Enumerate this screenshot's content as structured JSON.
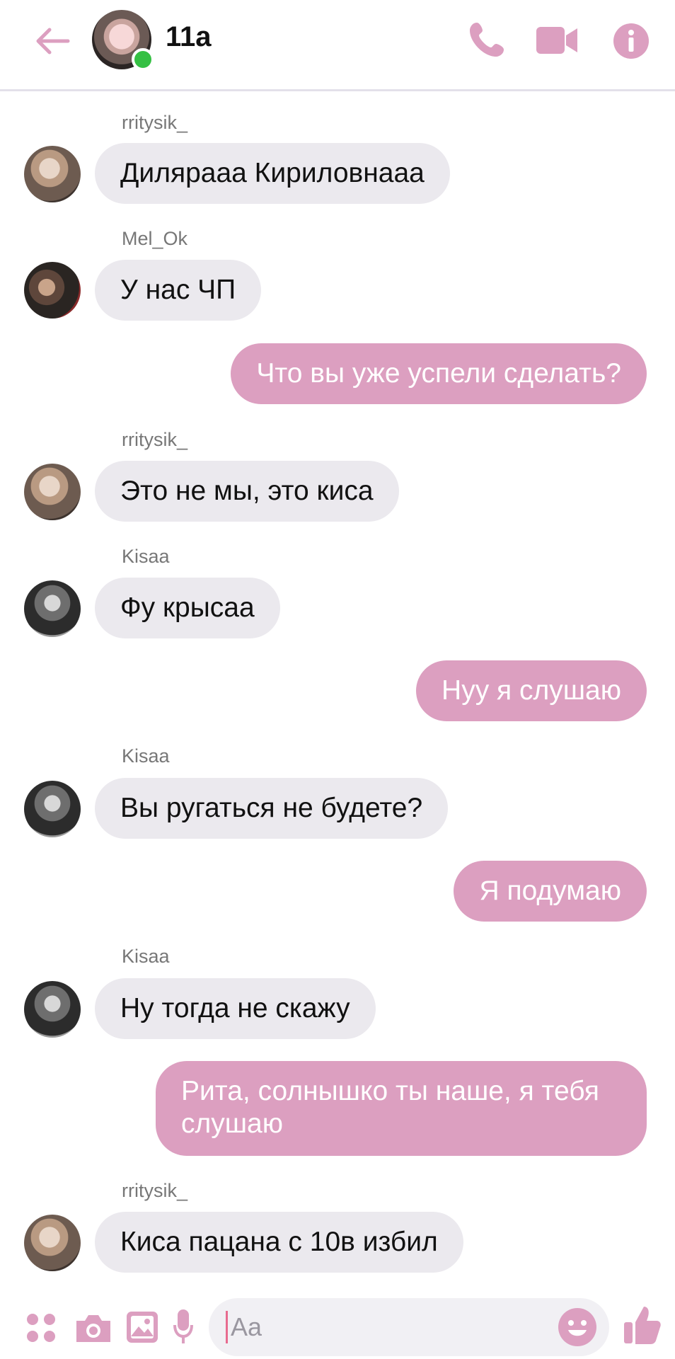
{
  "header": {
    "title": "11a",
    "icons": [
      "back-arrow-icon",
      "phone-icon",
      "video-icon",
      "info-icon"
    ],
    "online": true,
    "accent_color": "#dc9fc0"
  },
  "messages": [
    {
      "sender": "rritysik_",
      "text": "Диляраaa Кириловнааа",
      "direction": "in"
    },
    {
      "sender": "Mel_Ok",
      "text": "У нас ЧП",
      "direction": "in"
    },
    {
      "text": "Что вы уже успели сделать?",
      "direction": "out"
    },
    {
      "sender": "rritysik_",
      "text": "Это не мы, это киса",
      "direction": "in"
    },
    {
      "sender": "Kisaa",
      "text": "Фу крысаа",
      "direction": "in"
    },
    {
      "text": "Нуу я слушаю",
      "direction": "out"
    },
    {
      "sender": "Kisaa",
      "text": "Вы ругаться не будете?",
      "direction": "in"
    },
    {
      "text": "Я подумаю",
      "direction": "out"
    },
    {
      "sender": "Kisaa",
      "text": "Ну тогда не скажу",
      "direction": "in"
    },
    {
      "text": "Рита, солнышко ты наше, я тебя слушаю",
      "direction": "out"
    },
    {
      "sender": "rritysik_",
      "text": "Киса пацана с 10в избил",
      "direction": "in"
    }
  ],
  "composer": {
    "placeholder": "Aa",
    "icons": [
      "apps-icon",
      "camera-icon",
      "gallery-icon",
      "microphone-icon",
      "emoji-icon",
      "thumbs-up-icon"
    ]
  }
}
